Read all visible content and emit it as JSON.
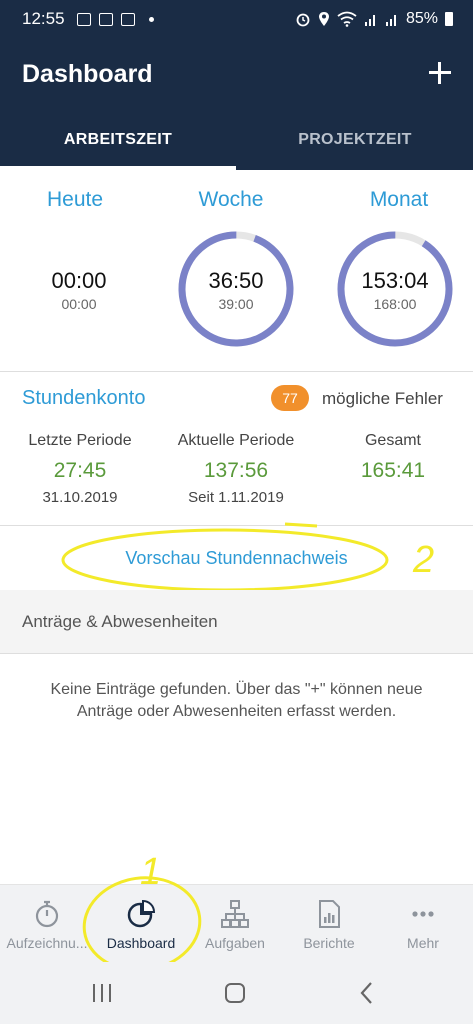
{
  "status_bar": {
    "time": "12:55",
    "battery": "85%"
  },
  "header": {
    "title": "Dashboard",
    "add_icon": "plus-icon"
  },
  "tabs": [
    {
      "label": "ARBEITSZEIT",
      "active": true
    },
    {
      "label": "PROJEKTZEIT",
      "active": false
    }
  ],
  "summary": {
    "today": {
      "title": "Heute",
      "value": "00:00",
      "target": "00:00"
    },
    "week": {
      "title": "Woche",
      "value": "36:50",
      "target": "39:00",
      "progress": 0.944
    },
    "month": {
      "title": "Monat",
      "value": "153:04",
      "target": "168:00",
      "progress": 0.911
    }
  },
  "account": {
    "title": "Stundenkonto",
    "error_count": "77",
    "error_label": "mögliche Fehler",
    "columns": [
      {
        "label": "Letzte Periode",
        "value": "27:45",
        "sub": "31.10.2019"
      },
      {
        "label": "Aktuelle Periode",
        "value": "137:56",
        "sub": "Seit 1.11.2019"
      },
      {
        "label": "Gesamt",
        "value": "165:41",
        "sub": ""
      }
    ]
  },
  "preview_link": "Vorschau Stundennachweis",
  "requests": {
    "title": "Anträge & Abwesenheiten",
    "empty_line1": "Keine Einträge gefunden. Über das \"+\" können neue",
    "empty_line2": "Anträge oder Abwesenheiten erfasst werden."
  },
  "annotations": {
    "number_1": "1",
    "number_2": "2"
  },
  "bottom_nav": [
    {
      "label": "Aufzeichnu...",
      "icon": "stopwatch-icon"
    },
    {
      "label": "Dashboard",
      "icon": "pie-chart-icon",
      "active": true
    },
    {
      "label": "Aufgaben",
      "icon": "hierarchy-icon"
    },
    {
      "label": "Berichte",
      "icon": "report-icon"
    },
    {
      "label": "Mehr",
      "icon": "more-icon"
    }
  ],
  "colors": {
    "header_bg": "#1a2c45",
    "accent": "#2e9bd6",
    "ring": "#7b82c8",
    "positive": "#5a9a3b",
    "badge": "#f1902c",
    "highlight": "#f3ea2a"
  }
}
